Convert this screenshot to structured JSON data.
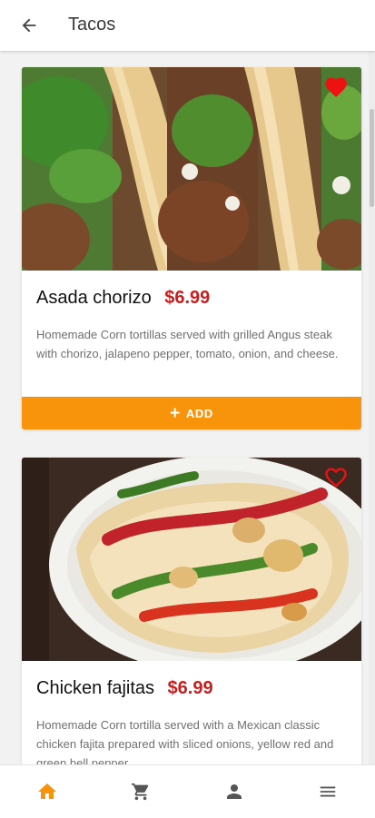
{
  "header": {
    "title": "Tacos",
    "back_icon": "arrow-back-icon"
  },
  "items": [
    {
      "name": "Asada chorizo",
      "price": "$6.99",
      "description": "Homemade Corn tortillas served with grilled Angus steak with chorizo, jalapeno pepper, tomato, onion, and cheese.",
      "favorite": true,
      "button_label": "ADD",
      "button_icon": "plus-icon"
    },
    {
      "name": "Chicken fajitas",
      "price": "$6.99",
      "description": "Homemade Corn tortilla served with a Mexican classic chicken fajita prepared with sliced onions, yellow red and green bell pepper.",
      "favorite": false
    }
  ],
  "bottom_nav": [
    {
      "icon": "home-icon",
      "active": true
    },
    {
      "icon": "cart-icon",
      "active": false
    },
    {
      "icon": "account-icon",
      "active": false
    },
    {
      "icon": "menu-icon",
      "active": false
    }
  ],
  "colors": {
    "accent": "#f7940c",
    "price": "#c71f1f",
    "favorite": "#ee1111",
    "nav_active": "#f7940c",
    "nav_inactive": "#555555"
  }
}
